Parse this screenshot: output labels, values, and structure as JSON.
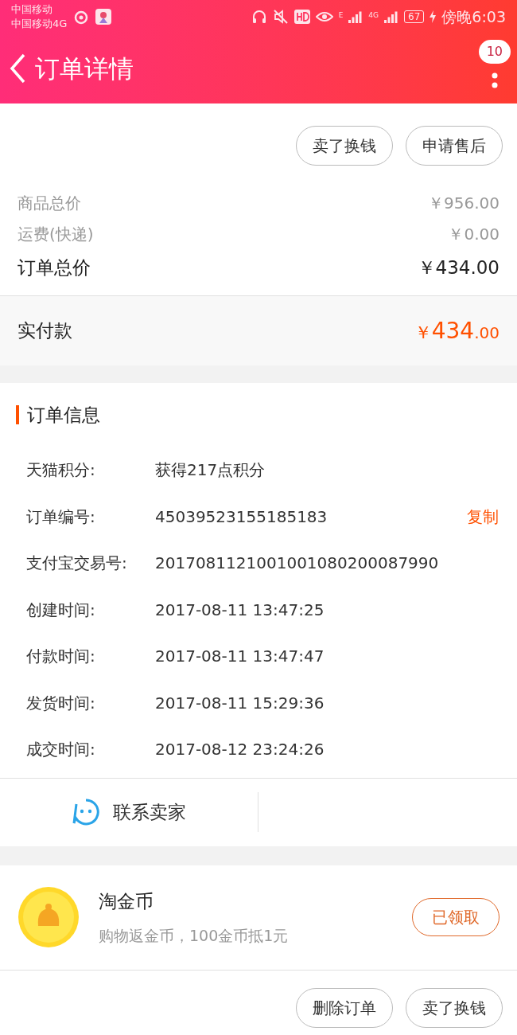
{
  "status_bar": {
    "carriers": [
      "中国移动",
      "中国移动4G"
    ],
    "network_1": "E",
    "network_2": "4G",
    "battery": "67",
    "time": "傍晚6:03"
  },
  "nav": {
    "title": "订单详情",
    "badge": "10"
  },
  "top_actions": [
    "卖了换钱",
    "申请售后"
  ],
  "prices": [
    {
      "label": "商品总价",
      "value": "￥956.00",
      "kind": "minor"
    },
    {
      "label": "运费(快递)",
      "value": "￥0.00",
      "kind": "minor"
    },
    {
      "label": "订单总价",
      "value": "￥434.00",
      "kind": "major"
    }
  ],
  "paid": {
    "label": "实付款",
    "currency": "￥",
    "integer": "434",
    "decimal": ".00"
  },
  "order_info": {
    "title": "订单信息",
    "rows": [
      {
        "label": "天猫积分:",
        "value": "获得217点积分"
      },
      {
        "label": "订单编号:",
        "value": "45039523155185183",
        "action": "复制"
      },
      {
        "label": "支付宝交易号:",
        "value": "2017081121001001080200087990"
      },
      {
        "label": "创建时间:",
        "value": "2017-08-11 13:47:25"
      },
      {
        "label": "付款时间:",
        "value": "2017-08-11 13:47:47"
      },
      {
        "label": "发货时间:",
        "value": "2017-08-11 15:29:36"
      },
      {
        "label": "成交时间:",
        "value": "2017-08-12 23:24:26"
      }
    ]
  },
  "contact": {
    "label": "联系卖家"
  },
  "coin": {
    "title": "淘金币",
    "subtitle": "购物返金币，100金币抵1元",
    "button": "已领取"
  },
  "bottom_actions": [
    "删除订单",
    "卖了换钱"
  ]
}
